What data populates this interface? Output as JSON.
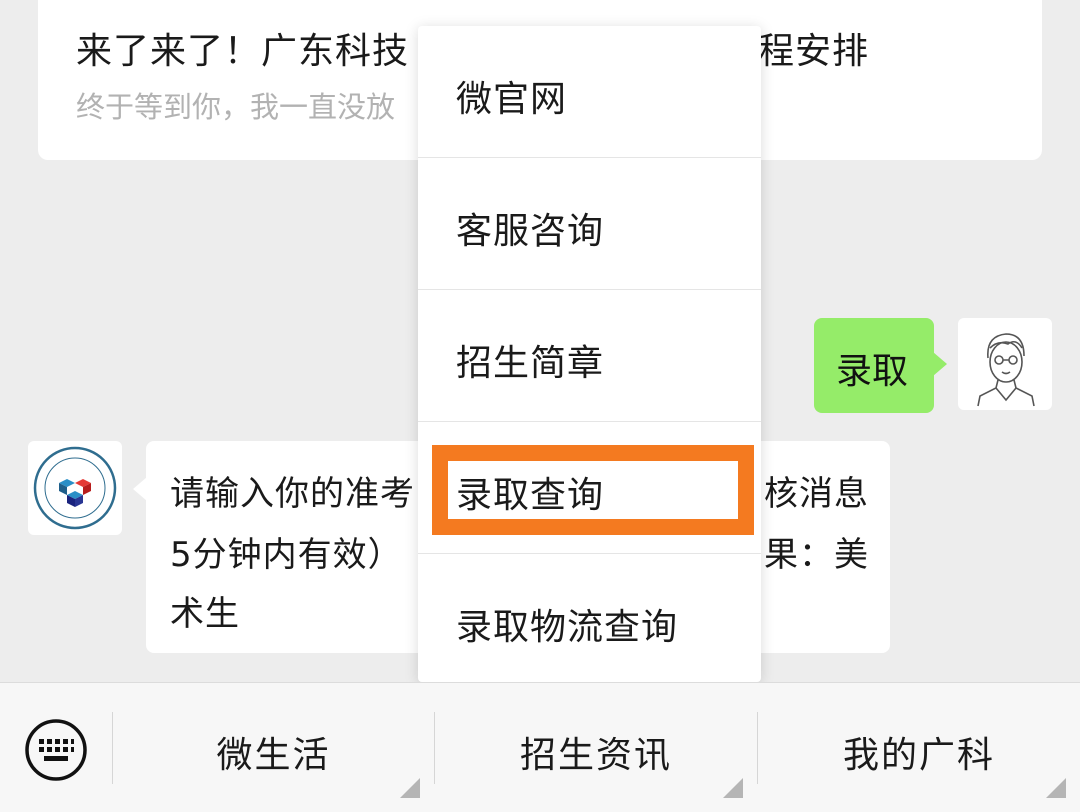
{
  "article": {
    "title_left": "来了来了！广东科技",
    "title_right": "程安排",
    "subtitle": "终于等到你，我一直没放"
  },
  "chat": {
    "user_message": "录取",
    "bot_message_lines": [
      {
        "left": "请输入你的准考",
        "right": "核消息"
      },
      {
        "left": "5分钟内有效）",
        "right": "果：美"
      },
      {
        "left": "术生",
        "right": ""
      }
    ]
  },
  "popup_menu": {
    "items": [
      "微官网",
      "客服咨询",
      "招生简章",
      "录取查询",
      "录取物流查询"
    ],
    "highlight_color": "#f47a20",
    "highlighted_item": "录取查询"
  },
  "bottom_bar": {
    "keyboard_icon": "keyboard-icon",
    "tabs": [
      "微生活",
      "招生资讯",
      "我的广科"
    ]
  },
  "colors": {
    "background": "#ededed",
    "user_bubble": "#95ec69",
    "accent": "#f47a20"
  }
}
